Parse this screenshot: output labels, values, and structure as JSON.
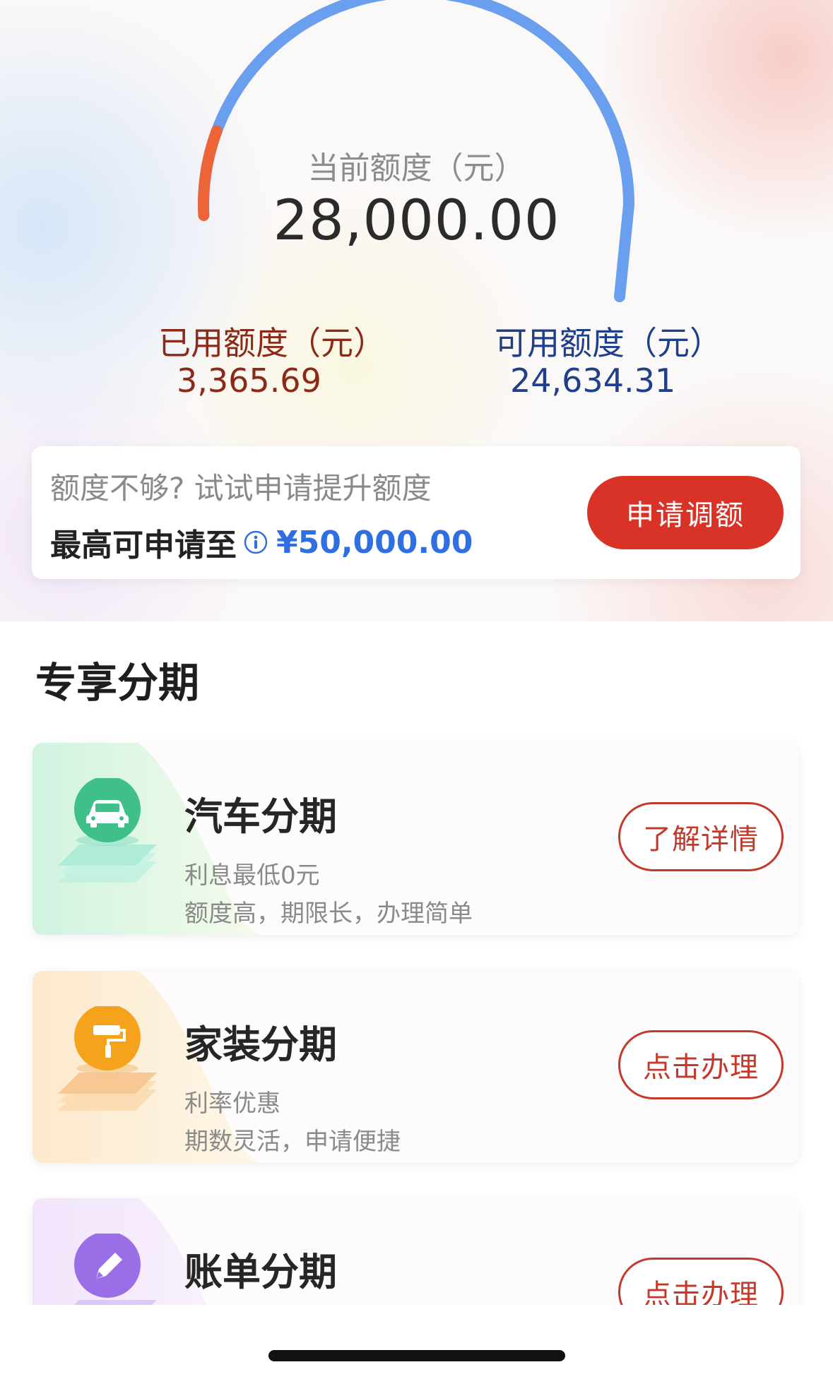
{
  "credit": {
    "current_label": "当前额度（元）",
    "current_value": "28,000.00",
    "used_label": "已用额度（元）",
    "used_value": "3,365.69",
    "available_label": "可用额度（元）",
    "available_value": "24,634.31",
    "used_ratio": 0.1202,
    "colors": {
      "used": "#ec6437",
      "available": "#6a9ff0"
    }
  },
  "apply": {
    "prompt": "额度不够? 试试申请提升额度",
    "max_label": "最高可申请至",
    "max_amount": "¥50,000.00",
    "button_label": "申请调额",
    "info_icon": "info-icon"
  },
  "section": {
    "title": "专享分期"
  },
  "products": [
    {
      "title": "汽车分期",
      "line1": "利息最低0元",
      "line2": "额度高，期限长，办理简单",
      "button": "了解详情",
      "icon": "car-icon",
      "theme": "#3fbf8a"
    },
    {
      "title": "家装分期",
      "line1": "利率优惠",
      "line2": "期数灵活，申请便捷",
      "button": "点击办理",
      "icon": "paint-roller-icon",
      "theme": "#f5a21c"
    },
    {
      "title": "账单分期",
      "line1": "",
      "line2": "",
      "button": "点击办理",
      "icon": "pencil-icon",
      "theme": "#9a6ee6"
    }
  ],
  "colors": {
    "accent_red": "#d93328",
    "link_blue": "#2f6fe2"
  }
}
